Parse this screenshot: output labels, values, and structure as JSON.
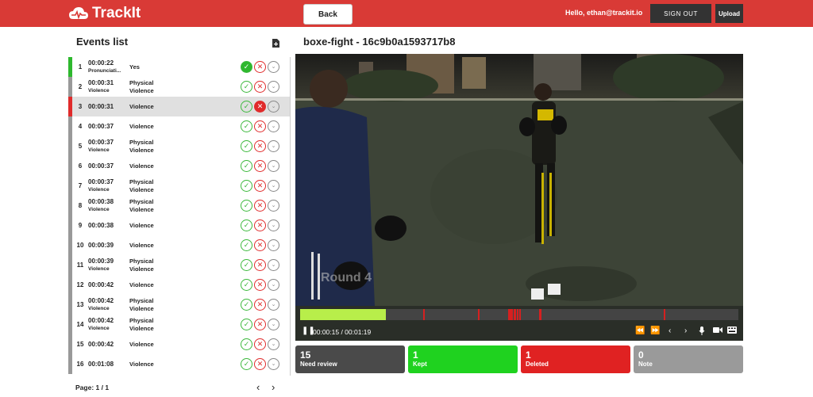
{
  "header": {
    "logo_text": "TrackIt",
    "back_label": "Back",
    "greeting": "Hello, ethan@trackit.io",
    "signout_label": "SIGN OUT",
    "upload_label": "Upload",
    "accent_color": "#d93a36"
  },
  "events": {
    "title": "Events list",
    "rows": [
      {
        "num": "1",
        "time": "00:00:22",
        "sub": "Pronunciati...",
        "cat1": "Yes",
        "cat2": "",
        "state": "kept"
      },
      {
        "num": "2",
        "time": "00:00:31",
        "sub": "Violence",
        "cat1": "Physical",
        "cat2": "Violence",
        "state": "none"
      },
      {
        "num": "3",
        "time": "00:00:31",
        "sub": "",
        "cat1": "Violence",
        "cat2": "",
        "state": "deleted"
      },
      {
        "num": "4",
        "time": "00:00:37",
        "sub": "",
        "cat1": "Violence",
        "cat2": "",
        "state": "none"
      },
      {
        "num": "5",
        "time": "00:00:37",
        "sub": "Violence",
        "cat1": "Physical",
        "cat2": "Violence",
        "state": "none"
      },
      {
        "num": "6",
        "time": "00:00:37",
        "sub": "",
        "cat1": "Violence",
        "cat2": "",
        "state": "none"
      },
      {
        "num": "7",
        "time": "00:00:37",
        "sub": "Violence",
        "cat1": "Physical",
        "cat2": "Violence",
        "state": "none"
      },
      {
        "num": "8",
        "time": "00:00:38",
        "sub": "Violence",
        "cat1": "Physical",
        "cat2": "Violence",
        "state": "none"
      },
      {
        "num": "9",
        "time": "00:00:38",
        "sub": "",
        "cat1": "Violence",
        "cat2": "",
        "state": "none"
      },
      {
        "num": "10",
        "time": "00:00:39",
        "sub": "",
        "cat1": "Violence",
        "cat2": "",
        "state": "none"
      },
      {
        "num": "11",
        "time": "00:00:39",
        "sub": "Violence",
        "cat1": "Physical",
        "cat2": "Violence",
        "state": "none"
      },
      {
        "num": "12",
        "time": "00:00:42",
        "sub": "",
        "cat1": "Violence",
        "cat2": "",
        "state": "none"
      },
      {
        "num": "13",
        "time": "00:00:42",
        "sub": "Violence",
        "cat1": "Physical",
        "cat2": "Violence",
        "state": "none"
      },
      {
        "num": "14",
        "time": "00:00:42",
        "sub": "Violence",
        "cat1": "Physical",
        "cat2": "Violence",
        "state": "none"
      },
      {
        "num": "15",
        "time": "00:00:42",
        "sub": "",
        "cat1": "Violence",
        "cat2": "",
        "state": "none"
      },
      {
        "num": "16",
        "time": "00:01:08",
        "sub": "",
        "cat1": "Violence",
        "cat2": "",
        "state": "none"
      }
    ],
    "page_label": "Page: 1 / 1"
  },
  "video": {
    "title": "boxe-fight - 16c9b0a1593717b8",
    "overlay_text": "Round 4",
    "time_display": "00:00:15 / 00:01:19",
    "played_fraction": 0.195,
    "event_marks": [
      0.28,
      0.405,
      0.475,
      0.478,
      0.482,
      0.487,
      0.49,
      0.495,
      0.5,
      0.545,
      0.548,
      0.83
    ]
  },
  "summary": [
    {
      "count": "15",
      "label": "Need review",
      "color": "#4a4a4a"
    },
    {
      "count": "1",
      "label": "Kept",
      "color": "#1fd21f"
    },
    {
      "count": "1",
      "label": "Deleted",
      "color": "#e02222"
    },
    {
      "count": "0",
      "label": "Note",
      "color": "#9a9a9a"
    }
  ]
}
